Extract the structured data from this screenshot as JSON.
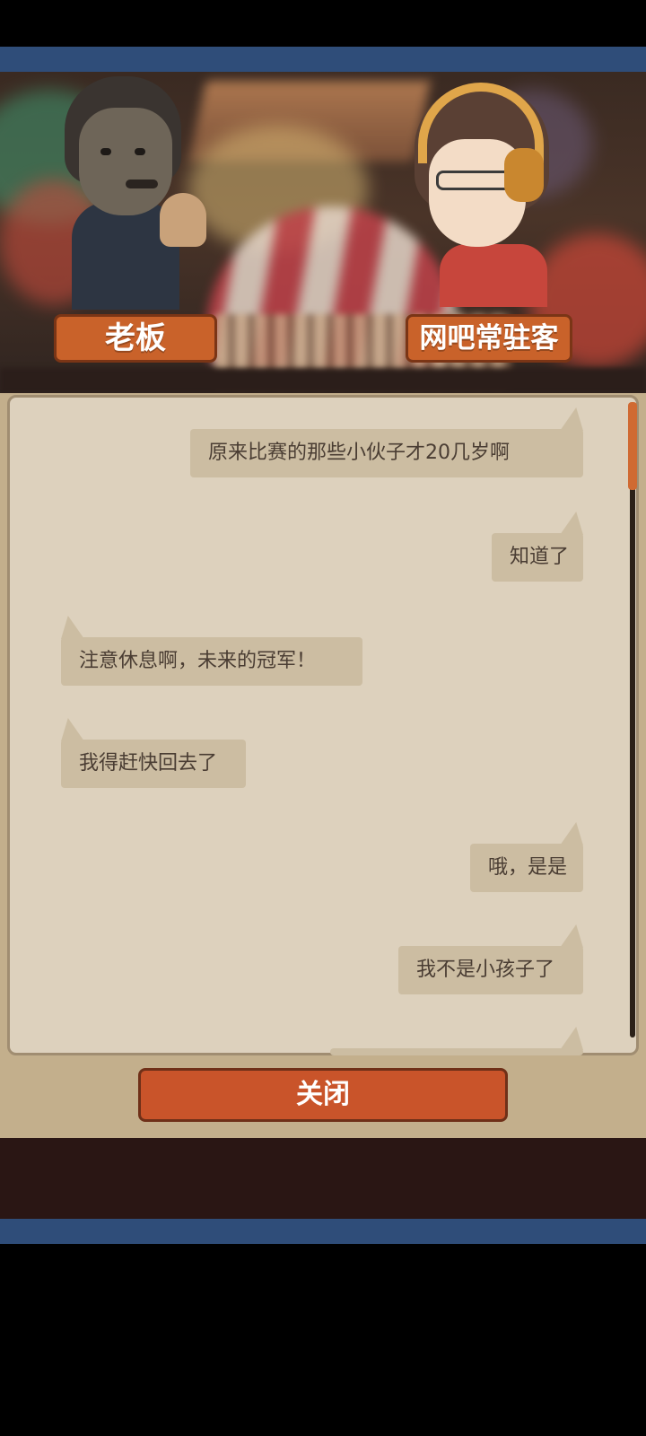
{
  "scene": {
    "speakers": [
      {
        "name": "老板"
      },
      {
        "name": "网吧常驻客"
      }
    ]
  },
  "chat": {
    "messages": [
      {
        "side": "right",
        "text": "原来比赛的那些小伙子才20几岁啊"
      },
      {
        "side": "right",
        "text": "知道了"
      },
      {
        "side": "left",
        "text": "注意休息啊，未来的冠军！"
      },
      {
        "side": "left",
        "text": "我得赶快回去了"
      },
      {
        "side": "right",
        "text": "哦，是是"
      },
      {
        "side": "right",
        "text": "我不是小孩子了"
      },
      {
        "side": "right",
        "text": ""
      }
    ]
  },
  "footer": {
    "close_label": "关闭"
  },
  "colors": {
    "accent": "#c9542a",
    "band": "#2f4d79",
    "bubble": "#ccbda2",
    "chat_bg": "#ddd1bd"
  }
}
